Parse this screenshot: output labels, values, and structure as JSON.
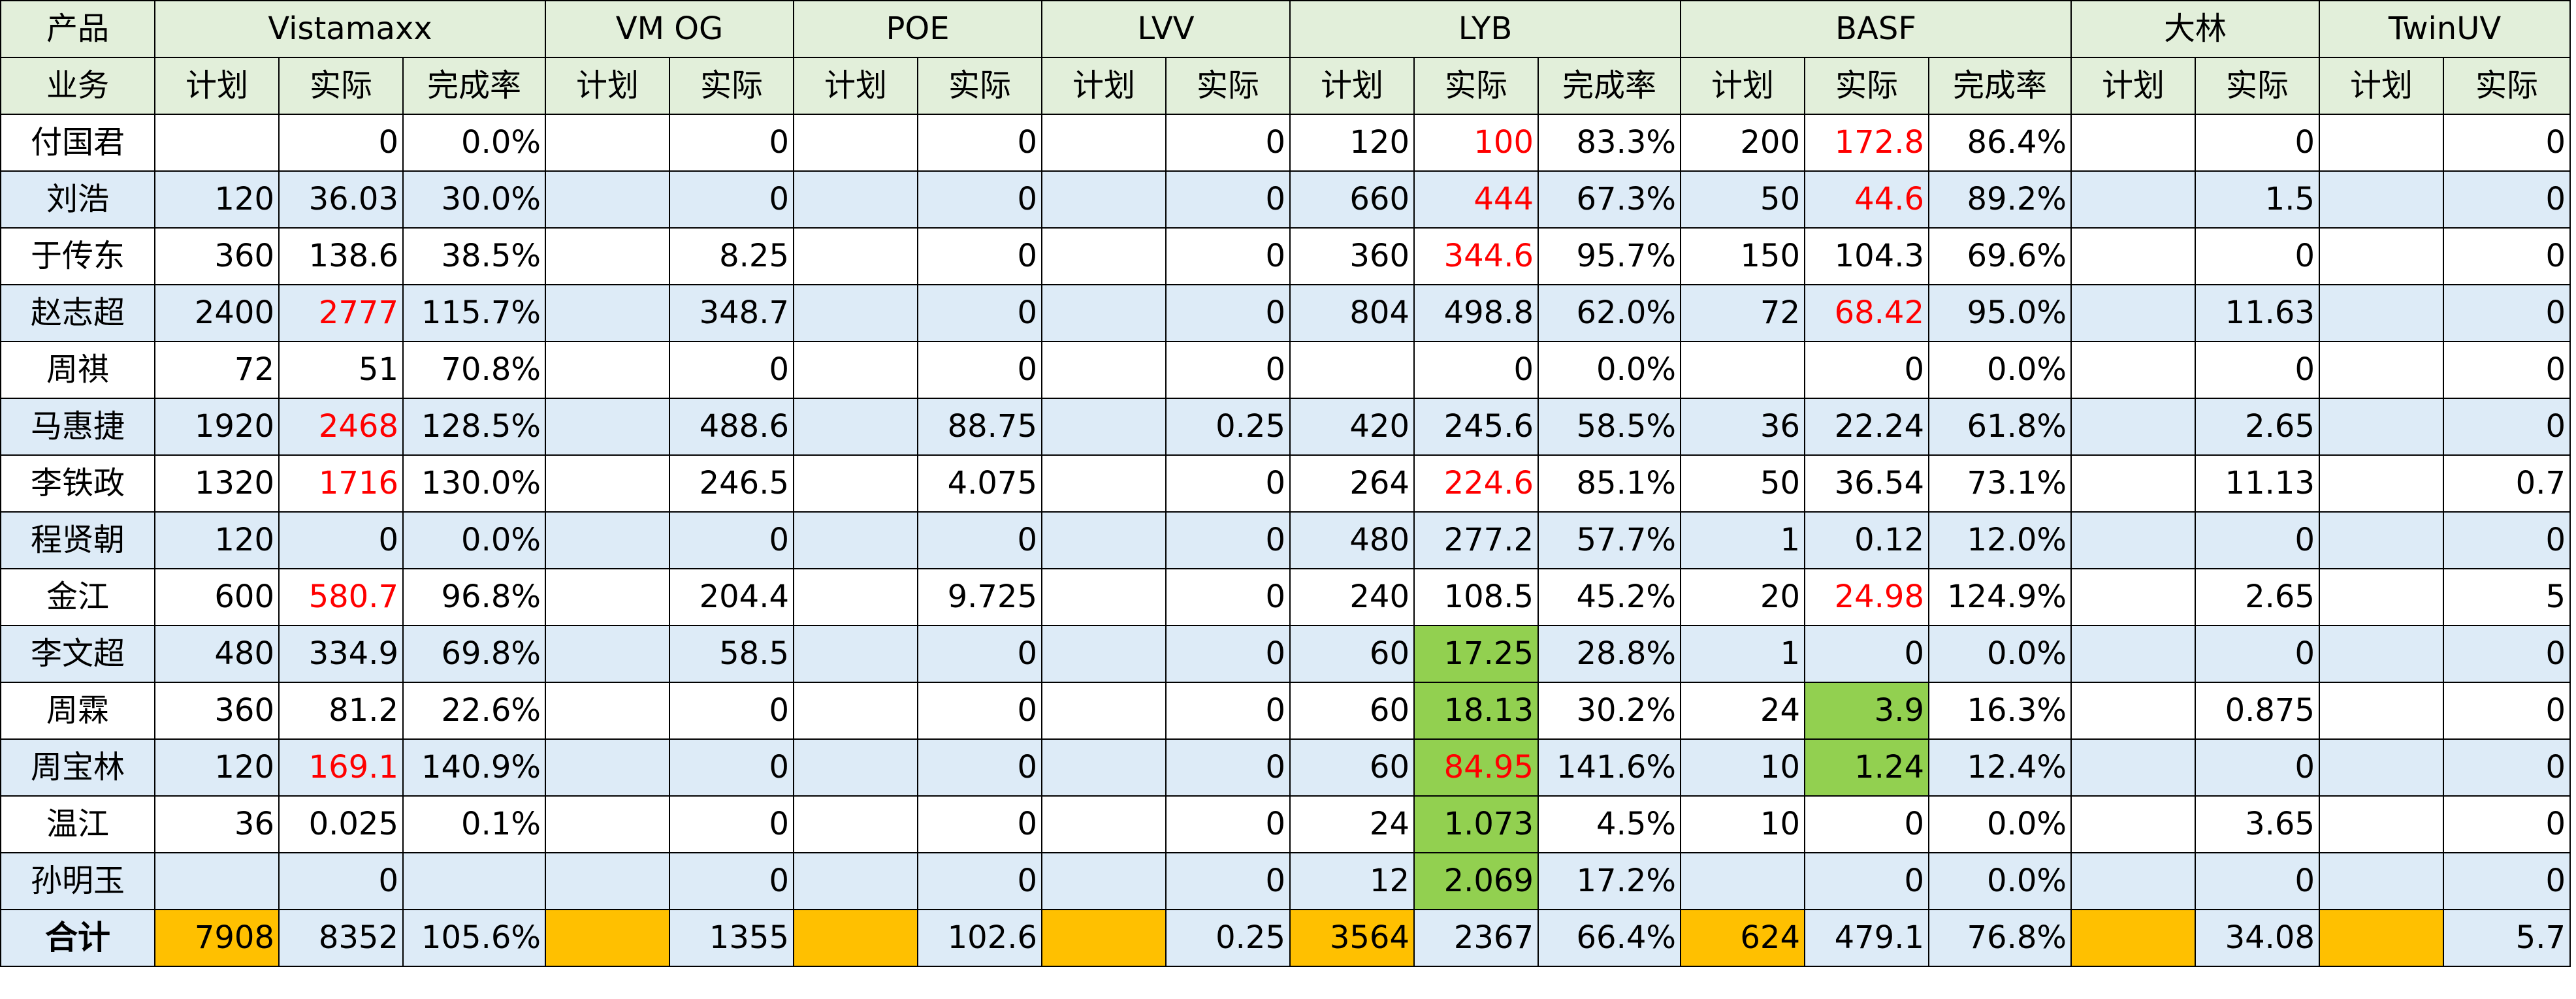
{
  "header": {
    "corner_top": "产品",
    "corner_bottom": "业务",
    "groups": [
      {
        "name": "Vistamaxx",
        "subs": [
          "计划",
          "实际",
          "完成率"
        ]
      },
      {
        "name": "VM OG",
        "subs": [
          "计划",
          "实际"
        ]
      },
      {
        "name": "POE",
        "subs": [
          "计划",
          "实际"
        ]
      },
      {
        "name": "LVV",
        "subs": [
          "计划",
          "实际"
        ]
      },
      {
        "name": "LYB",
        "subs": [
          "计划",
          "实际",
          "完成率"
        ]
      },
      {
        "name": "BASF",
        "subs": [
          "计划",
          "实际",
          "完成率"
        ]
      },
      {
        "name": "大林",
        "subs": [
          "计划",
          "实际"
        ]
      },
      {
        "name": "TwinUV",
        "subs": [
          "计划",
          "实际"
        ]
      }
    ]
  },
  "rows": [
    {
      "name": "付国君",
      "cells": [
        "",
        "0",
        "0.0%",
        "",
        "0",
        "",
        "0",
        "",
        "0",
        "120",
        "100",
        "83.3%",
        "200",
        "172.8",
        "86.4%",
        "",
        "0",
        "",
        "0"
      ]
    },
    {
      "name": "刘浩",
      "cells": [
        "120",
        "36.03",
        "30.0%",
        "",
        "0",
        "",
        "0",
        "",
        "0",
        "660",
        "444",
        "67.3%",
        "50",
        "44.6",
        "89.2%",
        "",
        "1.5",
        "",
        "0"
      ]
    },
    {
      "name": "于传东",
      "cells": [
        "360",
        "138.6",
        "38.5%",
        "",
        "8.25",
        "",
        "0",
        "",
        "0",
        "360",
        "344.6",
        "95.7%",
        "150",
        "104.3",
        "69.6%",
        "",
        "0",
        "",
        "0"
      ]
    },
    {
      "name": "赵志超",
      "cells": [
        "2400",
        "2777",
        "115.7%",
        "",
        "348.7",
        "",
        "0",
        "",
        "0",
        "804",
        "498.8",
        "62.0%",
        "72",
        "68.42",
        "95.0%",
        "",
        "11.63",
        "",
        "0"
      ]
    },
    {
      "name": "周祺",
      "cells": [
        "72",
        "51",
        "70.8%",
        "",
        "0",
        "",
        "0",
        "",
        "0",
        "",
        "0",
        "0.0%",
        "",
        "0",
        "0.0%",
        "",
        "0",
        "",
        "0"
      ]
    },
    {
      "name": "马惠捷",
      "cells": [
        "1920",
        "2468",
        "128.5%",
        "",
        "488.6",
        "",
        "88.75",
        "",
        "0.25",
        "420",
        "245.6",
        "58.5%",
        "36",
        "22.24",
        "61.8%",
        "",
        "2.65",
        "",
        "0"
      ]
    },
    {
      "name": "李铁政",
      "cells": [
        "1320",
        "1716",
        "130.0%",
        "",
        "246.5",
        "",
        "4.075",
        "",
        "0",
        "264",
        "224.6",
        "85.1%",
        "50",
        "36.54",
        "73.1%",
        "",
        "11.13",
        "",
        "0.7"
      ]
    },
    {
      "name": "程贤朝",
      "cells": [
        "120",
        "0",
        "0.0%",
        "",
        "0",
        "",
        "0",
        "",
        "0",
        "480",
        "277.2",
        "57.7%",
        "1",
        "0.12",
        "12.0%",
        "",
        "0",
        "",
        "0"
      ]
    },
    {
      "name": "金江",
      "cells": [
        "600",
        "580.7",
        "96.8%",
        "",
        "204.4",
        "",
        "9.725",
        "",
        "0",
        "240",
        "108.5",
        "45.2%",
        "20",
        "24.98",
        "124.9%",
        "",
        "2.65",
        "",
        "5"
      ]
    },
    {
      "name": "李文超",
      "cells": [
        "480",
        "334.9",
        "69.8%",
        "",
        "58.5",
        "",
        "0",
        "",
        "0",
        "60",
        "17.25",
        "28.8%",
        "1",
        "0",
        "0.0%",
        "",
        "0",
        "",
        "0"
      ]
    },
    {
      "name": "周霖",
      "cells": [
        "360",
        "81.2",
        "22.6%",
        "",
        "0",
        "",
        "0",
        "",
        "0",
        "60",
        "18.13",
        "30.2%",
        "24",
        "3.9",
        "16.3%",
        "",
        "0.875",
        "",
        "0"
      ]
    },
    {
      "name": "周宝林",
      "cells": [
        "120",
        "169.1",
        "140.9%",
        "",
        "0",
        "",
        "0",
        "",
        "0",
        "60",
        "84.95",
        "141.6%",
        "10",
        "1.24",
        "12.4%",
        "",
        "0",
        "",
        "0"
      ]
    },
    {
      "name": "温江",
      "cells": [
        "36",
        "0.025",
        "0.1%",
        "",
        "0",
        "",
        "0",
        "",
        "0",
        "24",
        "1.073",
        "4.5%",
        "10",
        "0",
        "0.0%",
        "",
        "3.65",
        "",
        "0"
      ]
    },
    {
      "name": "孙明玉",
      "cells": [
        "",
        "0",
        "",
        "",
        "0",
        "",
        "0",
        "",
        "0",
        "12",
        "2.069",
        "17.2%",
        "",
        "0",
        "0.0%",
        "",
        "0",
        "",
        "0"
      ]
    }
  ],
  "total": {
    "name": "合计",
    "cells": [
      "7908",
      "8352",
      "105.6%",
      "",
      "1355",
      "",
      "102.6",
      "",
      "0.25",
      "3564",
      "2367",
      "66.4%",
      "624",
      "479.1",
      "76.8%",
      "",
      "34.08",
      "",
      "5.7"
    ]
  },
  "highlights": {
    "red_text": [
      [
        0,
        10
      ],
      [
        0,
        13
      ],
      [
        1,
        10
      ],
      [
        1,
        13
      ],
      [
        2,
        10
      ],
      [
        3,
        1
      ],
      [
        3,
        13
      ],
      [
        5,
        1
      ],
      [
        6,
        1
      ],
      [
        6,
        10
      ],
      [
        8,
        1
      ],
      [
        8,
        13
      ],
      [
        11,
        1
      ],
      [
        11,
        10
      ]
    ],
    "green_fill": [
      [
        9,
        10
      ],
      [
        10,
        10
      ],
      [
        11,
        10
      ],
      [
        12,
        10
      ],
      [
        13,
        10
      ],
      [
        10,
        13
      ],
      [
        11,
        13
      ]
    ],
    "orange_fill_total": [
      0,
      3,
      5,
      7,
      9,
      12,
      15,
      17
    ]
  },
  "colors": {
    "header_bg": "#E2EFDA",
    "band_bg": "#DDEBF7",
    "red_text": "#FF0000",
    "green_fill": "#92D050",
    "orange_fill": "#FFC000"
  }
}
